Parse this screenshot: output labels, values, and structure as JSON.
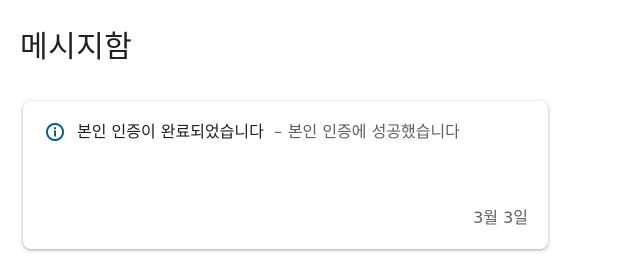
{
  "page": {
    "title": "메시지함"
  },
  "messages": [
    {
      "icon": "info-icon",
      "title": "본인 인증이 완료되었습니다",
      "separator": "–",
      "subtitle": "본인 인증에 성공했습니다",
      "date": "3월 3일",
      "accent_color": "#0b5e7a"
    }
  ]
}
